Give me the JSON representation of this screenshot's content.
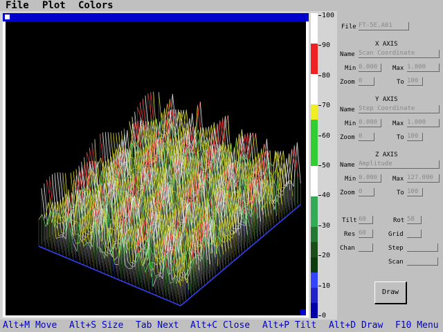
{
  "menu": {
    "file": "File",
    "plot": "Plot",
    "colors": "Colors"
  },
  "scale": {
    "ticks": [
      "100",
      "90",
      "80",
      "70",
      "60",
      "50",
      "40",
      "30",
      "20",
      "10",
      "0"
    ],
    "colors": [
      "#ffffff",
      "#ffffff",
      "#ee2222",
      "#ee2222",
      "#ffffff",
      "#ffffff",
      "#eeee22",
      "#33cc33",
      "#33cc33",
      "#33cc33",
      "#ffffff",
      "#ffffff",
      "#33aa55",
      "#33aa55",
      "#227733",
      "#1a4f1a",
      "#0b3a0b",
      "#3344ff",
      "#2222cc",
      "#0000aa"
    ]
  },
  "panel": {
    "file_label": "File",
    "file_value": "FT-5E.A01",
    "x_axis": {
      "heading": "X AXIS",
      "name_label": "Name",
      "name": "Scan Coordinate",
      "min_label": "Min",
      "min": "0.000",
      "max_label": "Max",
      "max": "1.000",
      "zoom_label": "Zoom",
      "zoom": "0",
      "to_label": "To",
      "to": "100"
    },
    "y_axis": {
      "heading": "Y AXIS",
      "name_label": "Name",
      "name": "Step Coordinate",
      "min_label": "Min",
      "min": "0.000",
      "max_label": "Max",
      "max": "1.000",
      "zoom_label": "Zoom",
      "zoom": "0",
      "to_label": "To",
      "to": "100"
    },
    "z_axis": {
      "heading": "Z AXIS",
      "name_label": "Name",
      "name": "Amplitude",
      "min_label": "Min",
      "min": "0.000",
      "max_label": "Max",
      "max": "127.000",
      "zoom_label": "Zoom",
      "zoom": "0",
      "to_label": "To",
      "to": "100"
    },
    "tilt_label": "Tilt",
    "tilt": "60",
    "rot_label": "Rot",
    "rot": "58",
    "res_label": "Res",
    "res": "60",
    "grid_label": "Grid",
    "grid": "",
    "chan_label": "Chan",
    "chan": "",
    "step_label": "Step",
    "step": "",
    "scan_label": "Scan",
    "scan": "",
    "draw_button": "Draw"
  },
  "status": {
    "move": "Alt+M Move",
    "size": "Alt+S Size",
    "next": "Tab Next",
    "close": "Alt+C Close",
    "tilt": "Alt+P Tilt",
    "draw": "Alt+D Draw",
    "menu": "F10 Menu"
  },
  "colors": {
    "accent": "#0000cc",
    "plot_bg": "#000000",
    "panel_bg": "#c0c0c0"
  }
}
